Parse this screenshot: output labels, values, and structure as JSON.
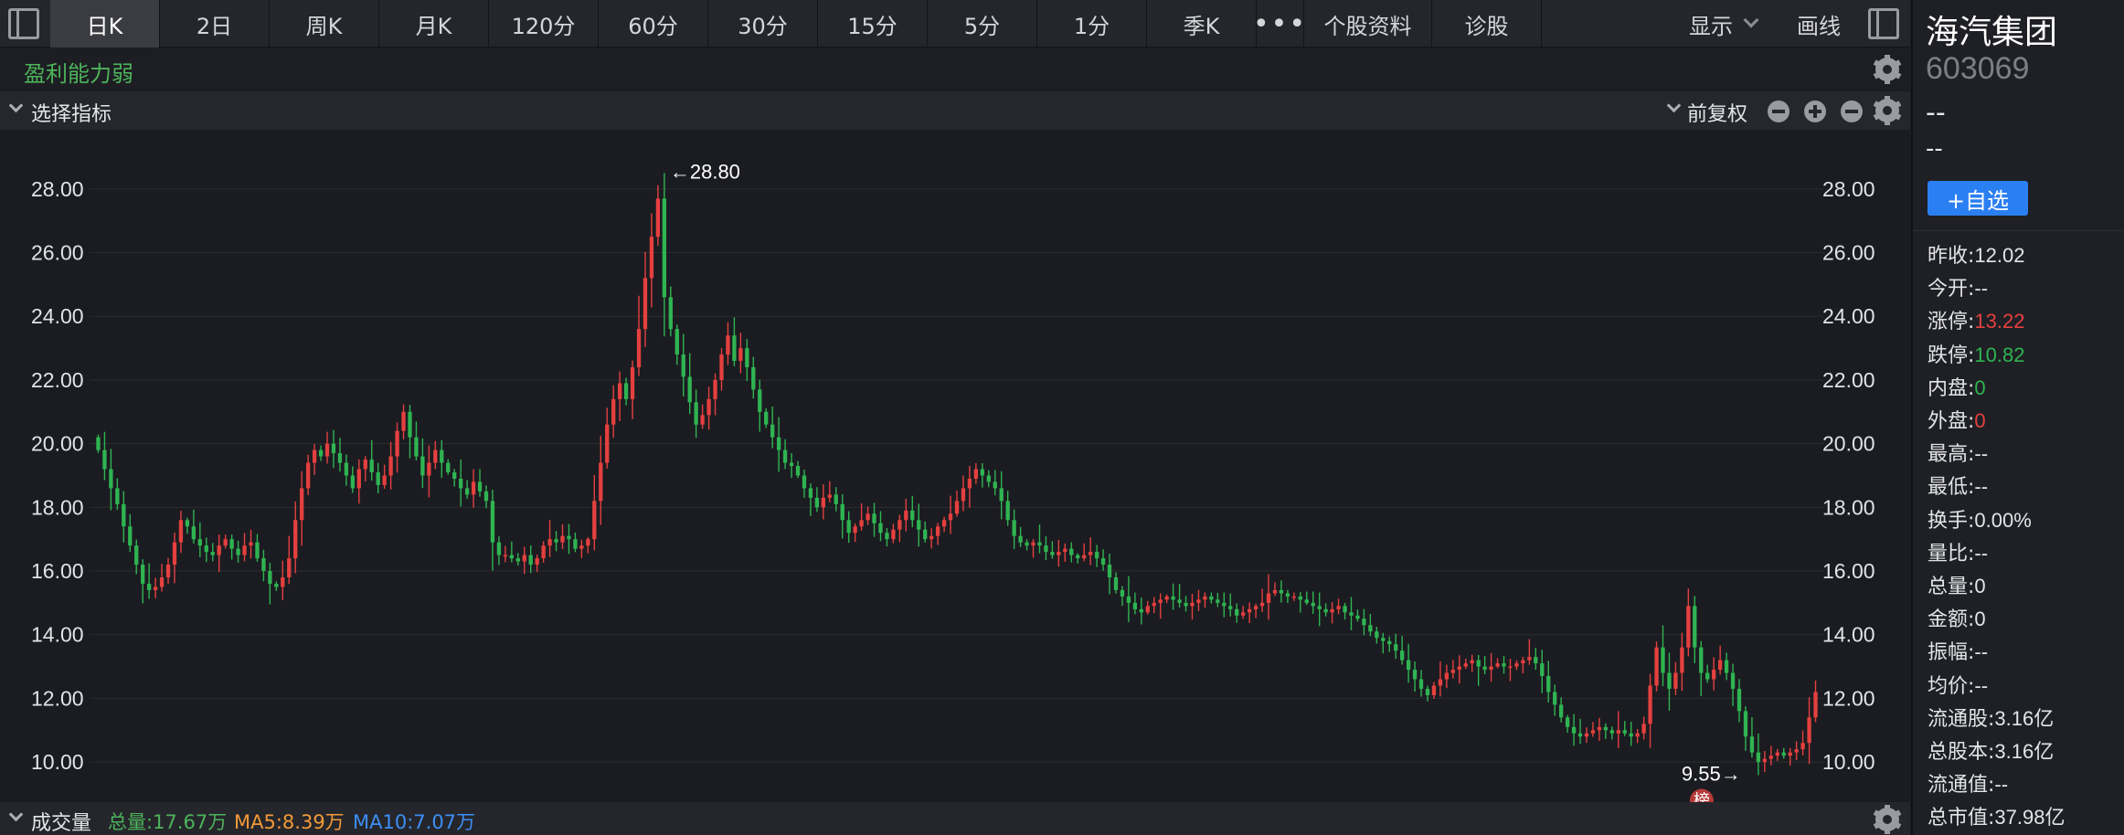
{
  "colors": {
    "up": "#e4403f",
    "down": "#2fb451",
    "status_green": "#4db35a",
    "accent_blue": "#2a7ff2",
    "ma5": "#f29a38",
    "ma10": "#3d8ef5"
  },
  "toolbar": {
    "tabs": [
      {
        "label": "日K",
        "active": true
      },
      {
        "label": "2日"
      },
      {
        "label": "周K"
      },
      {
        "label": "月K"
      },
      {
        "label": "120分"
      },
      {
        "label": "60分"
      },
      {
        "label": "30分"
      },
      {
        "label": "15分"
      },
      {
        "label": "5分"
      },
      {
        "label": "1分"
      },
      {
        "label": "季K"
      }
    ],
    "more": "•••",
    "profile": "个股资料",
    "diagnose": "诊股",
    "display": "显示",
    "draw": "画线",
    "icons": {
      "left": "panel-left-icon",
      "right": "panel-right-icon"
    }
  },
  "status": {
    "text": "盈利能力弱"
  },
  "indicator": {
    "label": "选择指标",
    "adjust": "前复权"
  },
  "chart_data": {
    "type": "candlestick",
    "y_ticks": [
      "28.00",
      "26.00",
      "24.00",
      "22.00",
      "20.00",
      "18.00",
      "16.00",
      "14.00",
      "12.00",
      "10.00"
    ],
    "ylim": [
      9.2,
      29.0
    ],
    "high_label": "←28.80",
    "low_label": "9.55→",
    "badge": "榜",
    "grid": true,
    "close_series": [
      19.8,
      19.2,
      18.6,
      18.1,
      17.4,
      16.8,
      16.2,
      15.6,
      15.4,
      15.5,
      15.8,
      16.2,
      16.9,
      17.6,
      17.4,
      17.0,
      16.8,
      16.6,
      16.5,
      16.8,
      17.0,
      16.7,
      16.5,
      16.8,
      16.9,
      16.4,
      16.0,
      15.6,
      15.5,
      15.8,
      16.4,
      17.6,
      18.6,
      19.4,
      19.8,
      19.6,
      20.0,
      19.7,
      19.4,
      19.0,
      18.6,
      19.2,
      19.5,
      19.1,
      18.7,
      19.0,
      19.6,
      20.4,
      21.0,
      20.2,
      19.6,
      19.0,
      19.4,
      19.8,
      19.4,
      19.1,
      18.9,
      18.6,
      18.4,
      18.8,
      18.5,
      18.2,
      16.9,
      16.5,
      16.5,
      16.4,
      16.3,
      16.5,
      16.2,
      16.4,
      16.8,
      17.0,
      16.9,
      17.1,
      17.0,
      16.7,
      16.8,
      17.0,
      18.2,
      19.4,
      20.6,
      21.4,
      21.9,
      21.4,
      22.4,
      23.6,
      25.2,
      26.5,
      27.7,
      24.6,
      23.6,
      22.8,
      22.1,
      21.3,
      20.6,
      20.9,
      21.4,
      22.0,
      22.8,
      23.4,
      22.6,
      23.0,
      22.4,
      21.7,
      21.0,
      20.6,
      20.2,
      19.8,
      19.4,
      19.3,
      19.0,
      18.6,
      18.3,
      18.0,
      18.3,
      18.4,
      18.1,
      17.6,
      17.2,
      17.4,
      17.6,
      17.8,
      17.5,
      17.2,
      17.0,
      17.3,
      17.6,
      17.9,
      17.6,
      17.3,
      17.0,
      17.1,
      17.4,
      17.6,
      17.8,
      18.2,
      18.6,
      18.9,
      19.2,
      19.0,
      18.8,
      18.6,
      18.2,
      17.6,
      17.1,
      16.9,
      16.8,
      16.9,
      16.8,
      16.6,
      16.5,
      16.6,
      16.7,
      16.5,
      16.4,
      16.5,
      16.6,
      16.4,
      16.2,
      15.8,
      15.4,
      15.2,
      15.0,
      14.8,
      14.7,
      14.9,
      15.0,
      15.1,
      15.2,
      15.1,
      15.0,
      14.9,
      15.0,
      15.1,
      15.2,
      15.1,
      15.0,
      14.9,
      14.8,
      14.6,
      14.7,
      14.8,
      14.9,
      15.0,
      15.3,
      15.4,
      15.3,
      15.2,
      15.2,
      15.1,
      15.0,
      14.9,
      14.8,
      14.7,
      14.8,
      14.9,
      14.7,
      14.6,
      14.5,
      14.3,
      14.1,
      13.9,
      13.8,
      13.7,
      13.5,
      13.2,
      12.9,
      12.6,
      12.3,
      12.1,
      12.4,
      12.6,
      12.8,
      12.9,
      13.0,
      13.1,
      13.2,
      13.0,
      12.9,
      13.0,
      13.1,
      13.0,
      13.0,
      13.1,
      13.2,
      13.3,
      13.1,
      12.7,
      12.2,
      11.8,
      11.4,
      11.1,
      10.9,
      10.8,
      10.9,
      11.0,
      11.1,
      11.0,
      10.9,
      11.0,
      10.9,
      10.8,
      10.9,
      11.2,
      12.4,
      13.6,
      12.8,
      12.3,
      12.8,
      13.6,
      14.9,
      13.6,
      12.8,
      12.6,
      12.9,
      13.2,
      12.8,
      12.3,
      11.6,
      10.8,
      10.3,
      10.0,
      10.1,
      10.2,
      10.3,
      10.2,
      10.3,
      10.4,
      10.6,
      11.4,
      12.2
    ]
  },
  "volume": {
    "label": "成交量",
    "total": "总量:17.67万",
    "ma5": "MA5:8.39万",
    "ma10": "MA10:7.07万"
  },
  "panel": {
    "name": "海汽集团",
    "code": "603069",
    "price": "--",
    "change": "--",
    "watch_button": "+自选",
    "stats": [
      {
        "label": "昨收:",
        "value": "12.02",
        "color": "#e3e4e7"
      },
      {
        "label": "今开:",
        "value": "--",
        "color": "#e3e4e7"
      },
      {
        "label": "涨停:",
        "value": "13.22",
        "color": "#e4403f"
      },
      {
        "label": "跌停:",
        "value": "10.82",
        "color": "#2fb451"
      },
      {
        "label": "内盘:",
        "value": "0",
        "color": "#2fb451"
      },
      {
        "label": "外盘:",
        "value": "0",
        "color": "#e4403f"
      },
      {
        "label": "最高:",
        "value": "--",
        "color": "#e3e4e7"
      },
      {
        "label": "最低:",
        "value": "--",
        "color": "#e3e4e7"
      },
      {
        "label": "换手:",
        "value": "0.00%",
        "color": "#e3e4e7"
      },
      {
        "label": "量比:",
        "value": "--",
        "color": "#e3e4e7"
      },
      {
        "label": "总量:",
        "value": "0",
        "color": "#e3e4e7"
      },
      {
        "label": "金额:",
        "value": "0",
        "color": "#e3e4e7"
      },
      {
        "label": "振幅:",
        "value": "--",
        "color": "#e3e4e7"
      },
      {
        "label": "均价:",
        "value": "--",
        "color": "#e3e4e7"
      },
      {
        "label": "流通股:",
        "value": "3.16亿",
        "color": "#e3e4e7"
      },
      {
        "label": "总股本:",
        "value": "3.16亿",
        "color": "#e3e4e7"
      },
      {
        "label": "流通值:",
        "value": "--",
        "color": "#e3e4e7"
      },
      {
        "label": "总市值:",
        "value": "37.98亿",
        "color": "#e3e4e7"
      }
    ]
  }
}
